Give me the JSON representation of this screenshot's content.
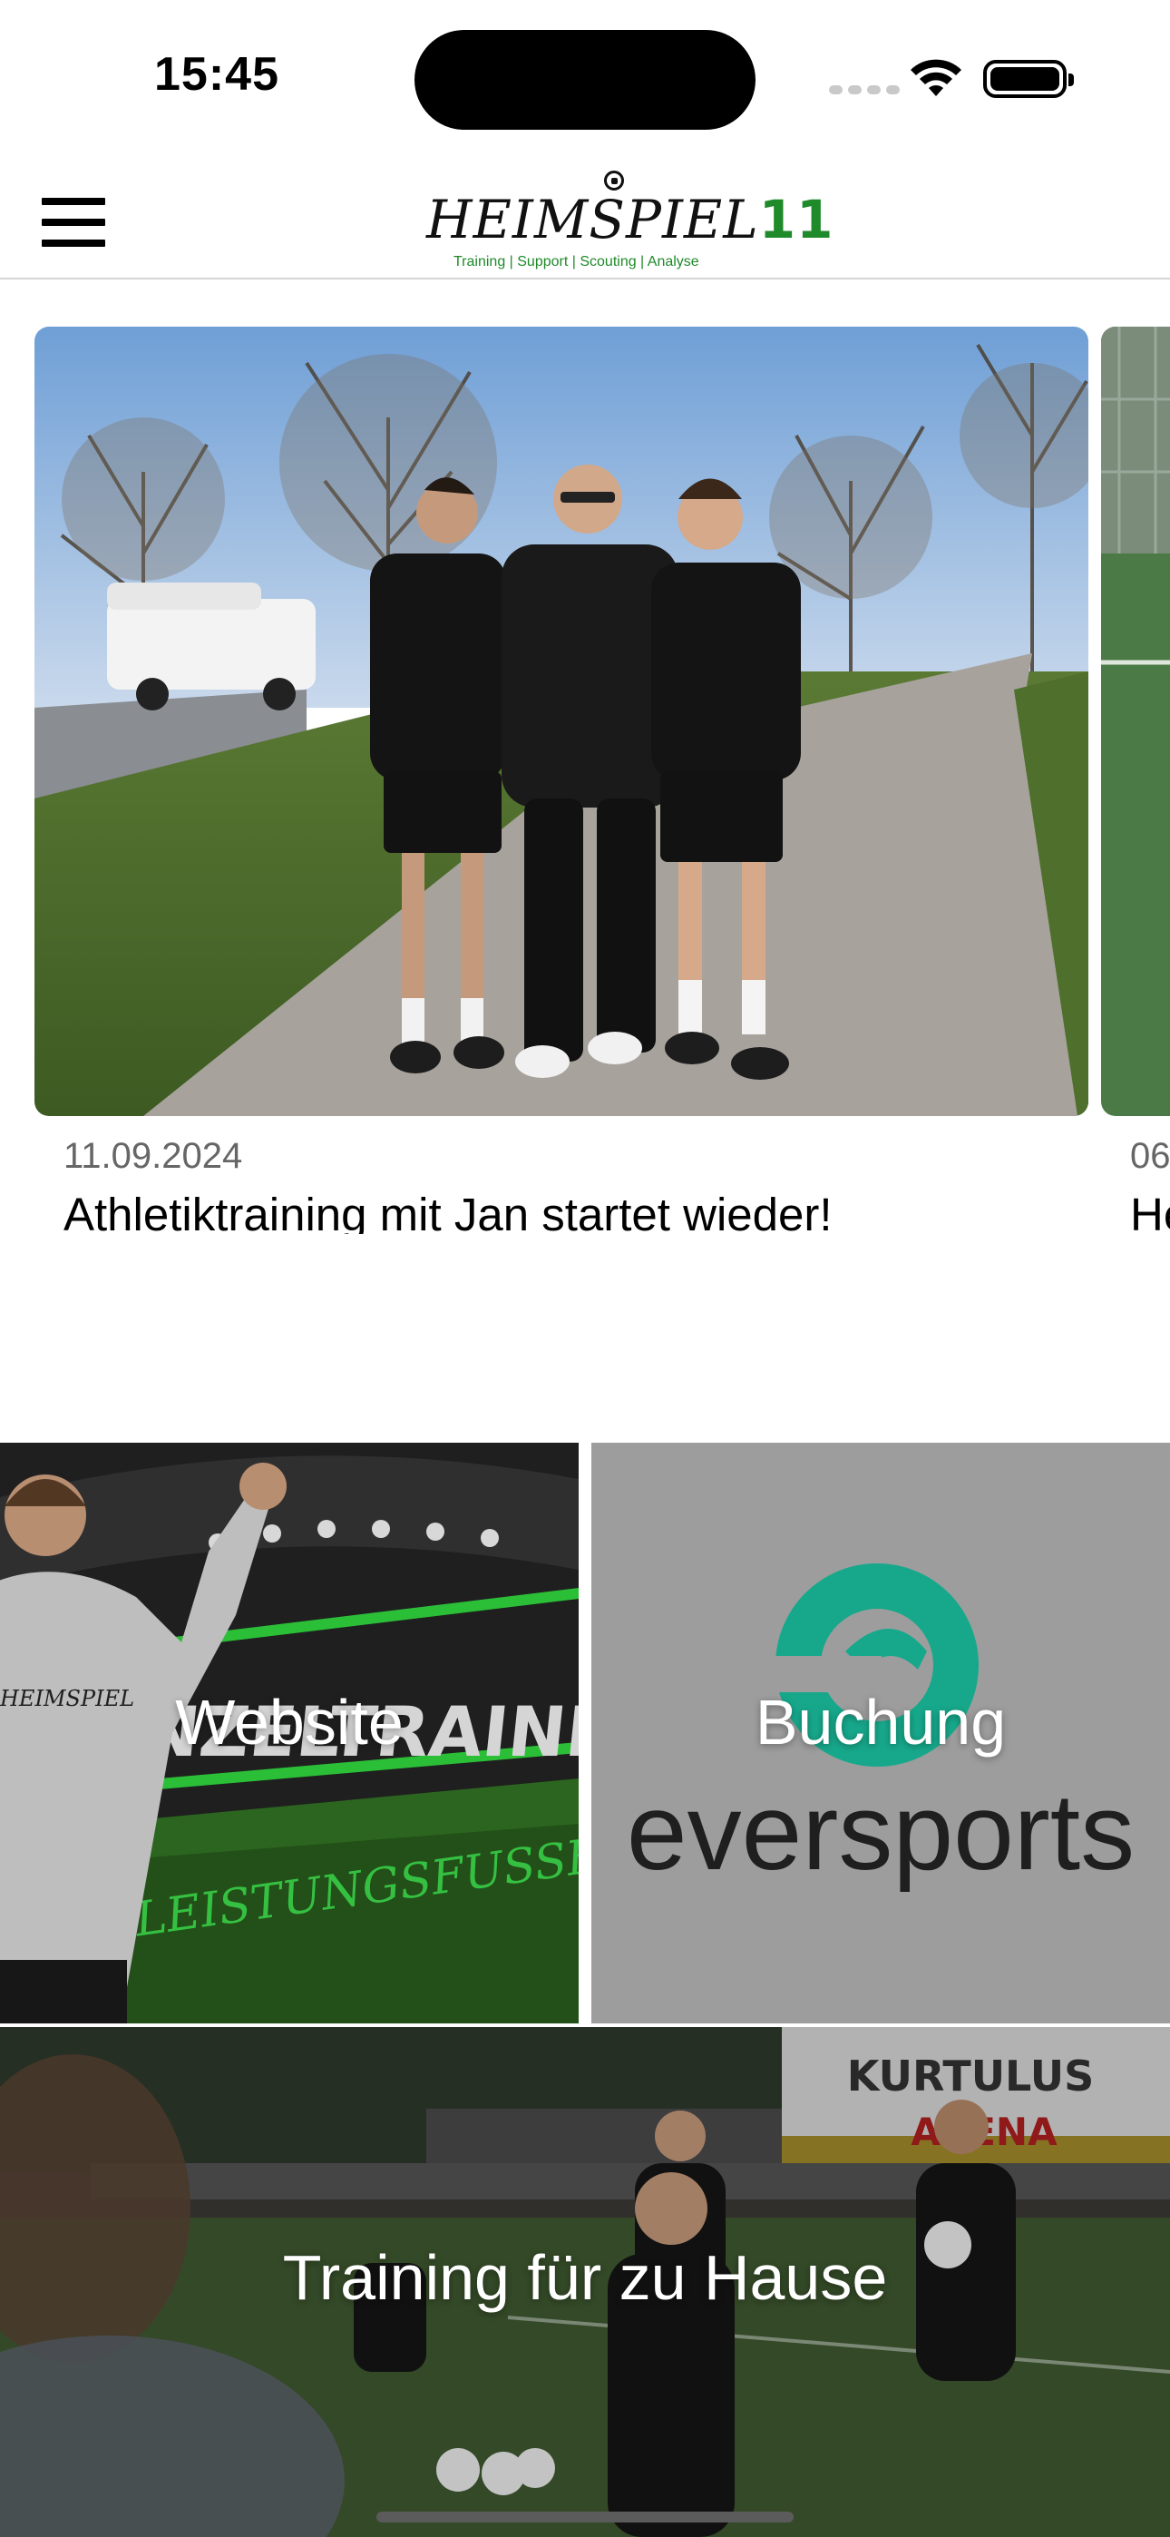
{
  "status_bar": {
    "time": "15:45",
    "icons": [
      "cellular-signal-icon",
      "wifi-icon",
      "battery-icon"
    ]
  },
  "header": {
    "menu_icon": "hamburger-menu-icon",
    "logo_text": "HEIMSPIEL",
    "logo_number": "11",
    "logo_tagline": "Training | Support | Scouting | Analyse",
    "brand_color": "#1f8a2a"
  },
  "news": [
    {
      "date": "11.09.2024",
      "title": "Athletiktraining mit Jan startet wieder!"
    },
    {
      "date": "06",
      "title": "He"
    }
  ],
  "tiles": {
    "website": {
      "label": "Website"
    },
    "booking": {
      "label": "Buchung"
    },
    "home_training": {
      "label": "Training für zu Hause"
    }
  },
  "tile_images": {
    "website_banner_text": "EINZELTRAINING FÜR DEN",
    "website_banner_script": "LEISTUNGSFUSSBALL",
    "booking_logo_text": "eversports",
    "arena_sign_line1": "KURTULUS",
    "arena_sign_line2": "ARENA"
  }
}
